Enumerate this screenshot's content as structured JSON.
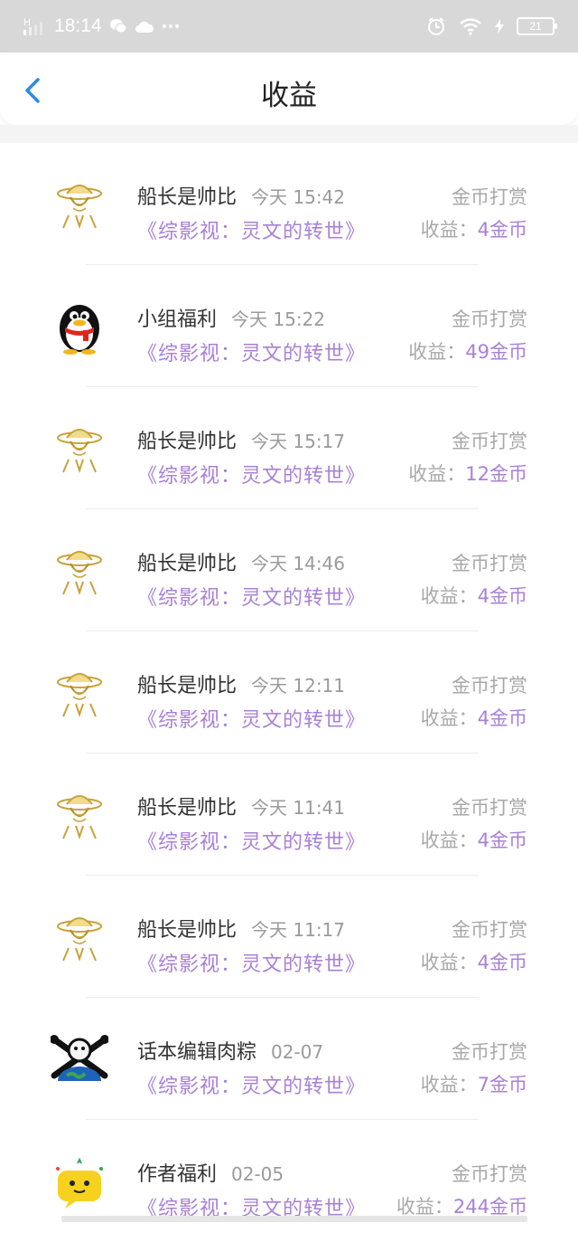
{
  "status_bar": {
    "time": "18:14",
    "signal_label": "H",
    "battery": "21",
    "icons": [
      "signal-icon",
      "wechat-icon",
      "cloud-icon",
      "more-icon",
      "alarm-icon",
      "wifi-icon",
      "battery-icon"
    ]
  },
  "header": {
    "title": "收益",
    "back_icon": "chevron-left-icon"
  },
  "colors": {
    "accent": "#a980d6",
    "back": "#2b8be6",
    "muted": "#a8a8a8"
  },
  "items": [
    {
      "name": "船长是帅比",
      "time": "今天 15:42",
      "type": "金币打赏",
      "book": "《综影视：灵文的转世》",
      "earn_label": "收益：",
      "earn_value": "4金币",
      "avatar": "straw-hat-avatar"
    },
    {
      "name": "小组福利",
      "time": "今天 15:22",
      "type": "金币打赏",
      "book": "《综影视：灵文的转世》",
      "earn_label": "收益：",
      "earn_value": "49金币",
      "avatar": "penguin-avatar"
    },
    {
      "name": "船长是帅比",
      "time": "今天 15:17",
      "type": "金币打赏",
      "book": "《综影视：灵文的转世》",
      "earn_label": "收益：",
      "earn_value": "12金币",
      "avatar": "straw-hat-avatar"
    },
    {
      "name": "船长是帅比",
      "time": "今天 14:46",
      "type": "金币打赏",
      "book": "《综影视：灵文的转世》",
      "earn_label": "收益：",
      "earn_value": "4金币",
      "avatar": "straw-hat-avatar"
    },
    {
      "name": "船长是帅比",
      "time": "今天 12:11",
      "type": "金币打赏",
      "book": "《综影视：灵文的转世》",
      "earn_label": "收益：",
      "earn_value": "4金币",
      "avatar": "straw-hat-avatar"
    },
    {
      "name": "船长是帅比",
      "time": "今天 11:41",
      "type": "金币打赏",
      "book": "《综影视：灵文的转世》",
      "earn_label": "收益：",
      "earn_value": "4金币",
      "avatar": "straw-hat-avatar"
    },
    {
      "name": "船长是帅比",
      "time": "今天 11:17",
      "type": "金币打赏",
      "book": "《综影视：灵文的转世》",
      "earn_label": "收益：",
      "earn_value": "4金币",
      "avatar": "straw-hat-avatar"
    },
    {
      "name": "话本编辑肉粽",
      "time": "02-07",
      "type": "金币打赏",
      "book": "《综影视：灵文的转世》",
      "earn_label": "收益：",
      "earn_value": "7金币",
      "avatar": "pirate-globe-avatar"
    },
    {
      "name": "作者福利",
      "time": "02-05",
      "type": "金币打赏",
      "book": "《综影视：灵文的转世》",
      "earn_label": "收益：",
      "earn_value": "244金币",
      "avatar": "chat-bubble-avatar"
    }
  ]
}
